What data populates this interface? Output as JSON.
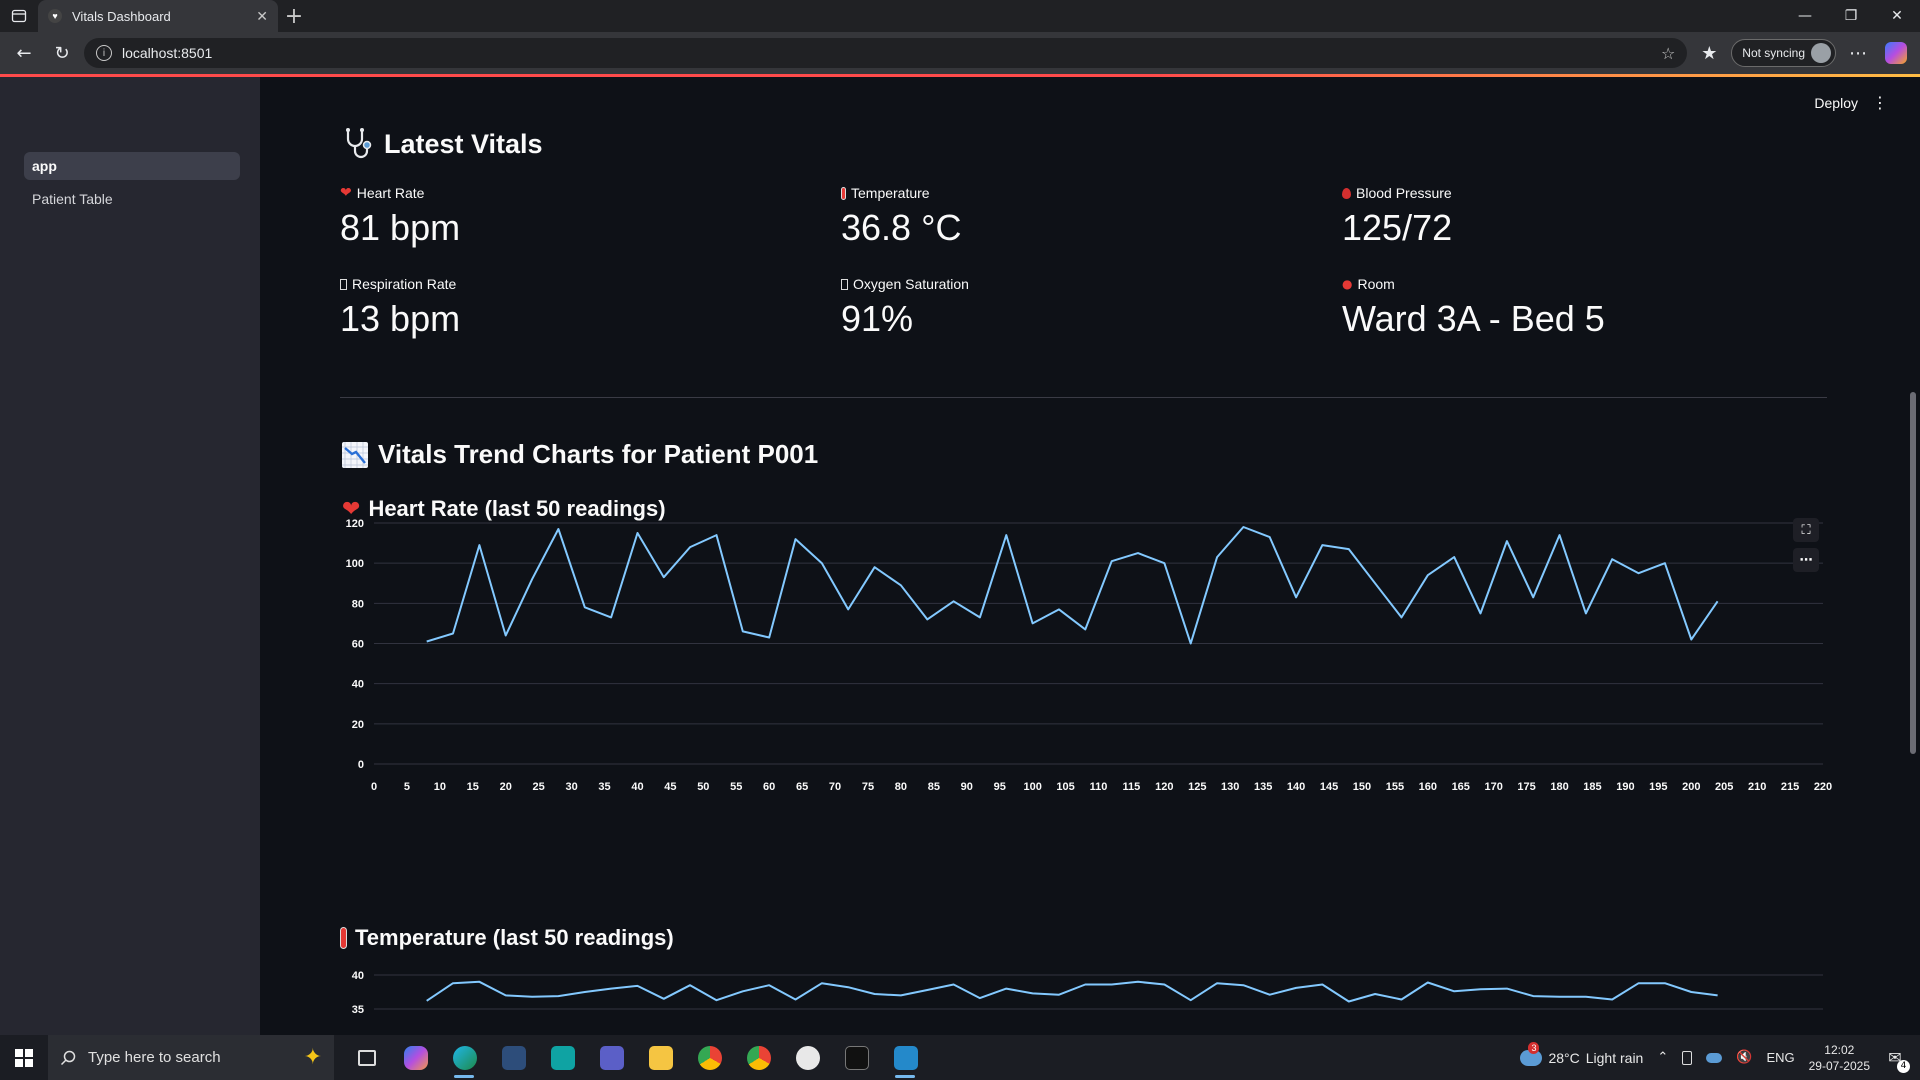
{
  "browser": {
    "tab_title": "Vitals Dashboard",
    "url": "localhost:8501",
    "sync_label": "Not syncing"
  },
  "app": {
    "deploy_label": "Deploy",
    "nav": [
      {
        "label": "app",
        "active": true
      },
      {
        "label": "Patient Table",
        "active": false
      }
    ],
    "latest_title": "Latest Vitals",
    "metrics": [
      {
        "label": "Heart Rate",
        "value": "81 bpm",
        "icon": "heart-icon"
      },
      {
        "label": "Temperature",
        "value": "36.8 °C",
        "icon": "thermometer-icon"
      },
      {
        "label": "Blood Pressure",
        "value": "125/72",
        "icon": "drop-icon"
      },
      {
        "label": "Respiration Rate",
        "value": "13 bpm",
        "icon": "missing-glyph-icon"
      },
      {
        "label": "Oxygen Saturation",
        "value": "91%",
        "icon": "missing-glyph-icon"
      },
      {
        "label": "Room",
        "value": "Ward 3A - Bed 5",
        "icon": "pin-icon"
      }
    ],
    "trend_title": "Vitals Trend Charts for Patient P001",
    "hr_chart_title": "Heart Rate (last 50 readings)",
    "temp_chart_title": "Temperature (last 50 readings)"
  },
  "chart_data": [
    {
      "type": "line",
      "title": "Heart Rate (last 50 readings)",
      "xlabel": "",
      "ylabel": "",
      "xlim": [
        0,
        220
      ],
      "ylim": [
        0,
        120
      ],
      "x_ticks": [
        0,
        5,
        10,
        15,
        20,
        25,
        30,
        35,
        40,
        45,
        50,
        55,
        60,
        65,
        70,
        75,
        80,
        85,
        90,
        95,
        100,
        105,
        110,
        115,
        120,
        125,
        130,
        135,
        140,
        145,
        150,
        155,
        160,
        165,
        170,
        175,
        180,
        185,
        190,
        195,
        200,
        205,
        210,
        215,
        220
      ],
      "y_ticks": [
        0,
        20,
        40,
        60,
        80,
        100,
        120
      ],
      "color": "#83c9ff",
      "x": [
        8,
        12,
        16,
        20,
        24,
        28,
        32,
        36,
        40,
        44,
        48,
        52,
        56,
        60,
        64,
        68,
        72,
        76,
        80,
        84,
        88,
        92,
        96,
        100,
        104,
        108,
        112,
        116,
        120,
        124,
        128,
        132,
        136,
        140,
        144,
        148,
        152,
        156,
        160,
        164,
        168,
        172,
        176,
        180,
        184,
        188,
        192,
        196,
        200,
        204
      ],
      "values": [
        61,
        65,
        109,
        64,
        92,
        117,
        78,
        73,
        115,
        93,
        108,
        114,
        66,
        63,
        112,
        100,
        77,
        98,
        89,
        72,
        81,
        73,
        114,
        70,
        77,
        67,
        101,
        105,
        100,
        60,
        103,
        118,
        113,
        83,
        109,
        107,
        90,
        73,
        94,
        103,
        75,
        111,
        83,
        114,
        75,
        102,
        95,
        100,
        62,
        81
      ]
    },
    {
      "type": "line",
      "title": "Temperature (last 50 readings)",
      "xlabel": "",
      "ylabel": "",
      "y_ticks": [
        35,
        40
      ],
      "color": "#83c9ff",
      "x": [
        8,
        12,
        16,
        20,
        24,
        28,
        32,
        36,
        40,
        44,
        48,
        52,
        56,
        60,
        64,
        68,
        72,
        76,
        80,
        84,
        88,
        92,
        96,
        100,
        104,
        108,
        112,
        116,
        120,
        124,
        128,
        132,
        136,
        140,
        144,
        148,
        152,
        156,
        160,
        164,
        168,
        172,
        176,
        180,
        184,
        188,
        192,
        196,
        200,
        204
      ],
      "values": [
        36.2,
        38.8,
        39.0,
        37.0,
        36.8,
        36.9,
        37.5,
        38.0,
        38.4,
        36.5,
        38.5,
        36.3,
        37.6,
        38.5,
        36.4,
        38.8,
        38.2,
        37.2,
        37.0,
        37.8,
        38.6,
        36.6,
        38.0,
        37.3,
        37.1,
        38.6,
        38.6,
        39.0,
        38.6,
        36.3,
        38.8,
        38.5,
        37.1,
        38.1,
        38.6,
        36.1,
        37.2,
        36.4,
        38.9,
        37.6,
        37.9,
        38.0,
        36.9,
        36.8,
        36.8,
        36.4,
        38.8,
        38.8,
        37.5,
        37.0
      ]
    }
  ],
  "taskbar": {
    "search_placeholder": "Type here to search",
    "weather_temp": "28°C",
    "weather_text": "Light rain",
    "lang": "ENG",
    "time": "12:02",
    "date": "29-07-2025",
    "notif_count": "4",
    "weather_badge": "3"
  }
}
